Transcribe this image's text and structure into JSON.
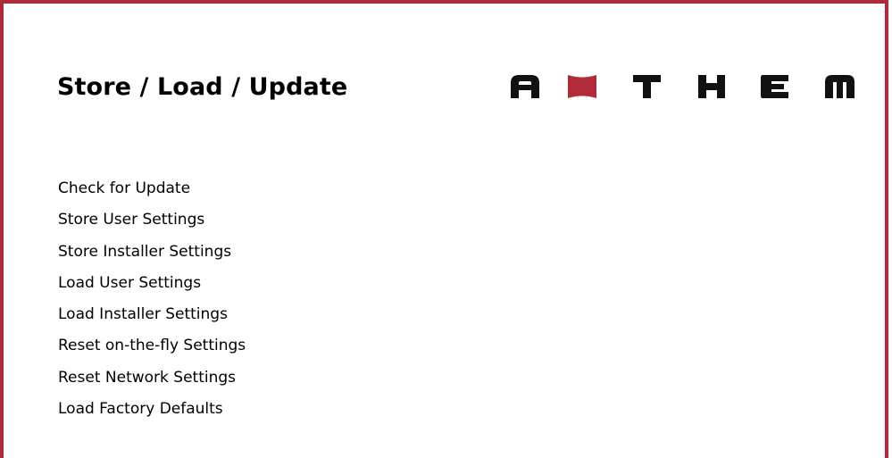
{
  "page": {
    "title": "Store / Load / Update"
  },
  "logo": {
    "text": "ANTHEM",
    "accent_color": "#b12a3a",
    "icon": "anthem-logo"
  },
  "menu": {
    "items": [
      {
        "label": "Check for Update"
      },
      {
        "label": "Store User Settings"
      },
      {
        "label": "Store Installer Settings"
      },
      {
        "label": "Load User Settings"
      },
      {
        "label": "Load Installer Settings"
      },
      {
        "label": "Reset on-the-fly Settings"
      },
      {
        "label": "Reset Network Settings"
      },
      {
        "label": "Load Factory Defaults"
      }
    ]
  },
  "colors": {
    "frame": "#b12a3a",
    "text": "#000000",
    "background": "#ffffff"
  }
}
